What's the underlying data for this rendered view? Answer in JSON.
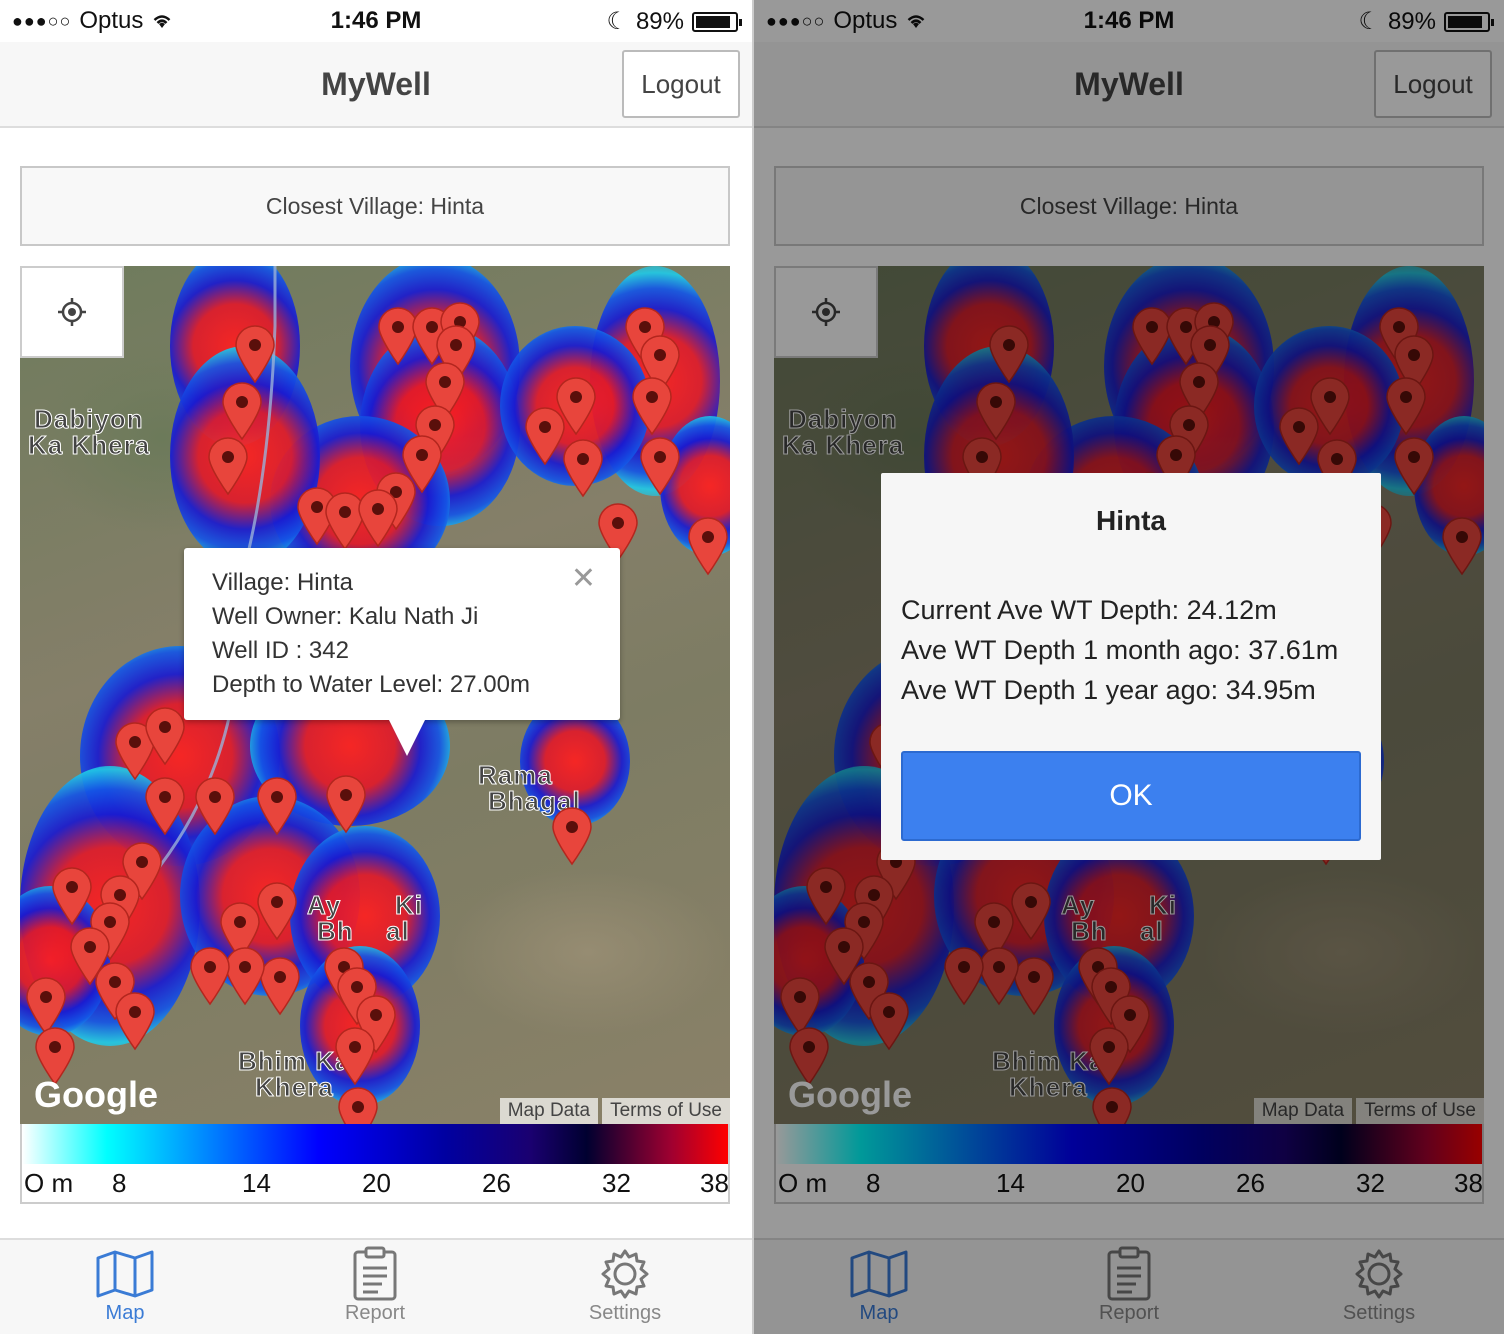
{
  "status": {
    "carrier": "Optus",
    "time": "1:46 PM",
    "battery": "89%",
    "battery_level": 0.89
  },
  "nav": {
    "title": "MyWell",
    "logout_label": "Logout"
  },
  "village_button": "Closest Village: Hinta",
  "map": {
    "labels": [
      "Dabiyon",
      "Ka Khera",
      "Rama",
      "Bhagal",
      "Ay",
      "Ki",
      "Bh",
      "al",
      "Bhim Ka",
      "Khera"
    ],
    "google": "Google",
    "map_data": "Map Data",
    "terms": "Terms of Use"
  },
  "info_window": {
    "village": "Village: Hinta",
    "owner": "Well Owner: Kalu Nath Ji",
    "well_id": "Well ID : 342",
    "depth": "Depth to Water Level: 27.00m"
  },
  "legend": {
    "ticks": [
      "O m",
      "8",
      "14",
      "20",
      "26",
      "32",
      "38"
    ]
  },
  "tabs": [
    {
      "label": "Map",
      "icon": "map-icon"
    },
    {
      "label": "Report",
      "icon": "clipboard-icon"
    },
    {
      "label": "Settings",
      "icon": "gear-icon"
    }
  ],
  "dialog": {
    "title": "Hinta",
    "line1": "Current Ave WT Depth: 24.12m",
    "line2": "Ave WT Depth 1 month ago: 37.61m",
    "line3": "Ave WT Depth 1 year ago: 34.95m",
    "ok_label": "OK"
  },
  "colors": {
    "accent": "#3a7bd5",
    "ok_button": "#3c80ef",
    "pin": "#e8453c"
  }
}
